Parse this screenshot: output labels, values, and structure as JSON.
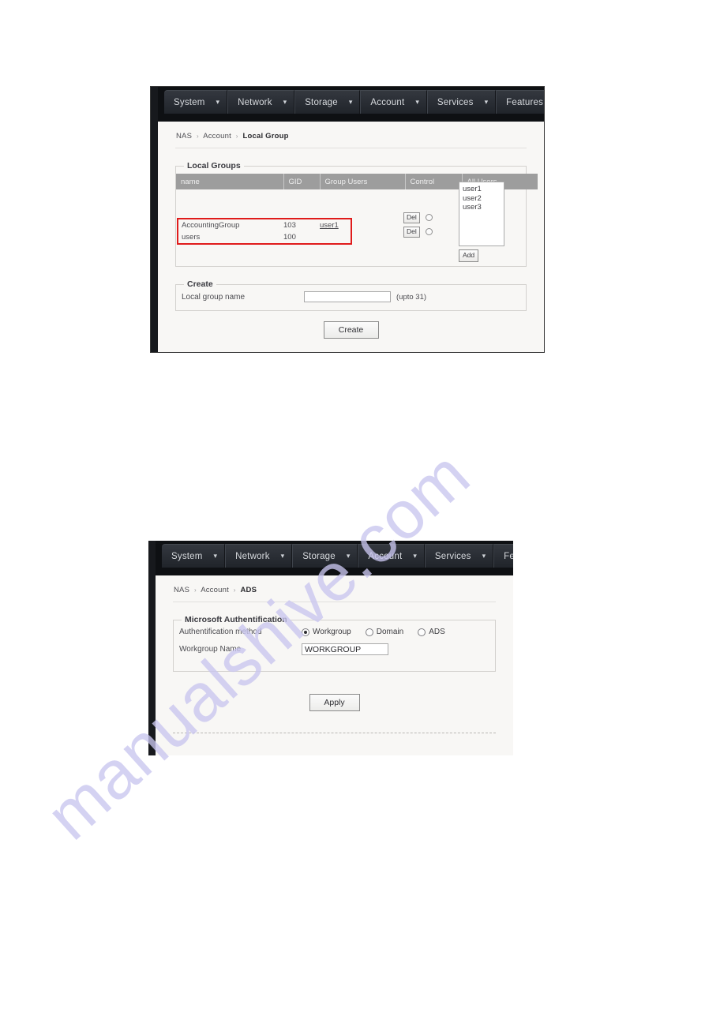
{
  "watermark": {
    "text": "manualshive.com",
    "color": "#c9c6ef"
  },
  "figures": [
    {
      "id": "local-group-page",
      "nav": {
        "items": [
          {
            "label": "System",
            "caret": "chevron-down-icon"
          },
          {
            "label": "Network",
            "caret": "chevron-down-icon"
          },
          {
            "label": "Storage",
            "caret": "chevron-down-icon"
          },
          {
            "label": "Account",
            "caret": "chevron-down-icon"
          },
          {
            "label": "Services",
            "caret": "chevron-down-icon"
          },
          {
            "label": "Features",
            "caret": "chevron-down-icon"
          }
        ]
      },
      "breadcrumb": {
        "root": "NAS",
        "mid": "Account",
        "last": "Local Group",
        "separator": "›"
      },
      "local_groups": {
        "legend": "Local Groups",
        "columns": [
          "name",
          "GID",
          "Group Users",
          "Control",
          "All Users"
        ],
        "rows": [
          {
            "name": "AccountingGroup",
            "gid": "103",
            "group_users": "user1",
            "control_label": "Del"
          },
          {
            "name": "users",
            "gid": "100",
            "group_users": "",
            "control_label": "Del"
          }
        ],
        "all_users": [
          "user1",
          "user2",
          "user3"
        ],
        "add_label": "Add",
        "highlight_color": "#e01b1b"
      },
      "create": {
        "legend": "Create",
        "field_label": "Local group name",
        "field_value": "",
        "field_placeholder": "",
        "hint": "(upto 31)",
        "submit_label": "Create"
      }
    },
    {
      "id": "ads-page",
      "nav": {
        "items": [
          {
            "label": "System",
            "caret": "chevron-down-icon"
          },
          {
            "label": "Network",
            "caret": "chevron-down-icon"
          },
          {
            "label": "Storage",
            "caret": "chevron-down-icon"
          },
          {
            "label": "Account",
            "caret": "chevron-down-icon"
          },
          {
            "label": "Services",
            "caret": "chevron-down-icon"
          },
          {
            "label": "Features",
            "caret": "chevron-down-icon"
          }
        ]
      },
      "breadcrumb": {
        "root": "NAS",
        "mid": "Account",
        "last": "ADS",
        "separator": "›"
      },
      "ms_auth": {
        "legend": "Microsoft Authentification",
        "method_label": "Authentification method",
        "methods": [
          {
            "label": "Workgroup",
            "selected": true
          },
          {
            "label": "Domain",
            "selected": false
          },
          {
            "label": "ADS",
            "selected": false
          }
        ],
        "workgroup_label": "Workgroup Name",
        "workgroup_value": "WORKGROUP",
        "workgroup_placeholder": ""
      },
      "submit_label": "Apply"
    }
  ]
}
